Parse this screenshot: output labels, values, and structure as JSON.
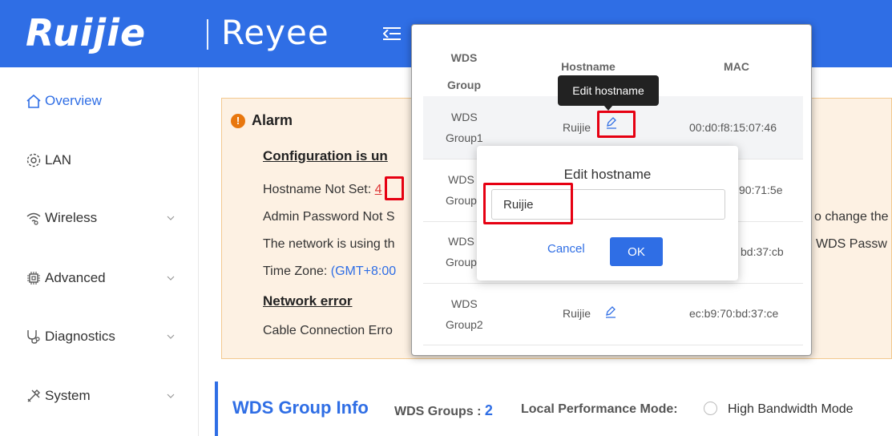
{
  "header": {
    "logo_ruijie": "Ruijie",
    "logo_reyee": "Reyee"
  },
  "sidebar": {
    "items": [
      {
        "label": "Overview",
        "icon": "home-icon",
        "active": true
      },
      {
        "label": "LAN",
        "icon": "gear-icon"
      },
      {
        "label": "Wireless",
        "icon": "wifi-icon"
      },
      {
        "label": "Advanced",
        "icon": "chip-icon"
      },
      {
        "label": "Diagnostics",
        "icon": "stethoscope-icon"
      },
      {
        "label": "System",
        "icon": "tools-icon"
      }
    ]
  },
  "alarm": {
    "title": "Alarm",
    "config_heading": "Configuration is un",
    "hostname_label": "Hostname Not Set: ",
    "hostname_count": "4",
    "admin_password": "Admin Password Not S",
    "admin_suffix": "o change the",
    "network_using": "The network is using th",
    "network_suffix": "WDS Passw",
    "timezone_label": "Time Zone: ",
    "timezone_value": "(GMT+8:00",
    "network_error": "Network error",
    "cable_error": "Cable Connection Erro"
  },
  "wds_info": {
    "title": "WDS Group Info",
    "groups_label": "WDS Groups : ",
    "groups_value": "2",
    "mode_label": "Local Performance Mode: ",
    "mode_value": "High Bandwidth Mode"
  },
  "popup": {
    "headers": {
      "group_line1": "WDS",
      "group_line2": "Group",
      "hostname": "Hostname",
      "mac": "MAC"
    },
    "rows": [
      {
        "group_line1": "WDS",
        "group_line2": "Group1",
        "hostname": "Ruijie",
        "mac": "00:d0:f8:15:07:46"
      },
      {
        "group_line1": "WDS",
        "group_line2": "Group",
        "hostname": "",
        "mac": "90:71:5e"
      },
      {
        "group_line1": "WDS",
        "group_line2": "Group",
        "hostname": "",
        "mac": "bd:37:cb"
      },
      {
        "group_line1": "WDS",
        "group_line2": "Group2",
        "hostname": "Ruijie",
        "mac": "ec:b9:70:bd:37:ce"
      }
    ]
  },
  "tooltip": {
    "text": "Edit hostname"
  },
  "dialog": {
    "title": "Edit hostname",
    "input_value": "Ruijie",
    "cancel": "Cancel",
    "ok": "OK"
  },
  "colors": {
    "brand_blue": "#2f6ee5",
    "alarm_bg": "#fdf1e3",
    "alarm_icon": "#e8770e",
    "highlight_red": "#e60012"
  }
}
